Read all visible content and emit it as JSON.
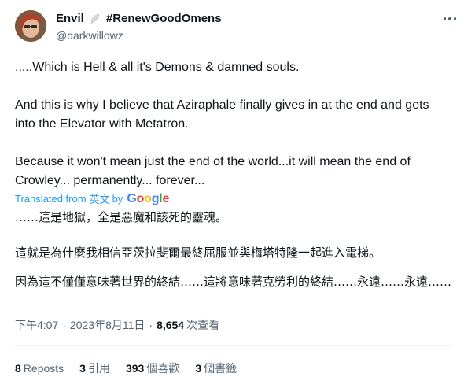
{
  "author": {
    "display_name": "Envil",
    "hashtag": "#RenewGoodOmens",
    "handle": "@darkwillowz",
    "feather_icon": "feather-icon"
  },
  "tweet": {
    "paragraphs_en": [
      ".....Which is Hell & all it's Demons & damned souls.",
      "And this is why I believe that Aziraphale finally gives in at the end and gets into the Elevator with Metatron.",
      "Because it won't mean just the end of the world...it will mean the end of Crowley... permanently... forever..."
    ],
    "translation": {
      "label": "Translated from",
      "language": "英文",
      "by": "by",
      "provider": "Google"
    },
    "paragraphs_zh": [
      "……這是地獄，全是惡魔和該死的靈魂。",
      "這就是為什麼我相信亞茨拉斐爾最終屈服並與梅塔特隆一起進入電梯。",
      "因為這不僅僅意味著世界的終結……這將意味著克勞利的終結……永遠……永遠……"
    ]
  },
  "meta": {
    "time": "下午4:07",
    "date": "2023年8月11日",
    "views_count": "8,654",
    "views_label": "次查看",
    "separator": "·"
  },
  "stats": {
    "reposts_count": "8",
    "reposts_label": "Reposts",
    "quotes_count": "3",
    "quotes_label": "引用",
    "likes_count": "393",
    "likes_label": "個喜歡",
    "bookmarks_count": "3",
    "bookmarks_label": "個書籤"
  },
  "colors": {
    "link": "#1d9bf0",
    "secondary_text": "#536471",
    "primary_text": "#0f1419",
    "divider": "#eff3f4"
  }
}
